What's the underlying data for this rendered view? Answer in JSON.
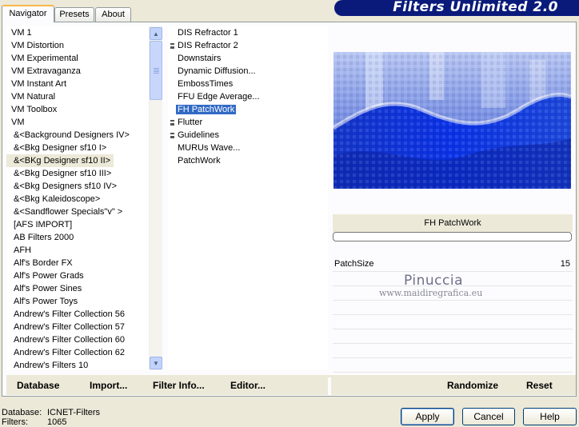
{
  "tabs": [
    {
      "label": "Navigator",
      "active": true
    },
    {
      "label": "Presets",
      "active": false
    },
    {
      "label": "About",
      "active": false
    }
  ],
  "banner": {
    "title": "Filters Unlimited 2.0"
  },
  "categories": {
    "items": [
      "VM 1",
      "VM Distortion",
      "VM Experimental",
      "VM Extravaganza",
      "VM Instant Art",
      "VM Natural",
      "VM Toolbox",
      "VM",
      "&<Background Designers IV>",
      "&<Bkg Designer sf10 I>",
      "&<BKg Designer sf10 II>",
      "&<Bkg Designer sf10 III>",
      "&<Bkg Designers sf10 IV>",
      "&<Bkg Kaleidoscope>",
      "&<Sandflower Specials\"v\" >",
      "[AFS IMPORT]",
      "AB Filters 2000",
      "AFH",
      "Alf's Border FX",
      "Alf's Power Grads",
      "Alf's Power Sines",
      "Alf's Power Toys",
      "Andrew's Filter Collection 56",
      "Andrew's Filter Collection 57",
      "Andrew's Filter Collection 60",
      "Andrew's Filter Collection 62",
      "Andrew's Filters 10"
    ],
    "selected": "&<BKg Designer sf10 II>"
  },
  "filters": {
    "items": [
      {
        "label": "DIS Refractor 1",
        "marker": false
      },
      {
        "label": "DIS Refractor 2",
        "marker": true
      },
      {
        "label": "Downstairs",
        "marker": false
      },
      {
        "label": "Dynamic Diffusion...",
        "marker": false
      },
      {
        "label": "EmbossTimes",
        "marker": false
      },
      {
        "label": "FFU Edge Average...",
        "marker": false
      },
      {
        "label": "FH PatchWork",
        "marker": false
      },
      {
        "label": "Flutter",
        "marker": true
      },
      {
        "label": "Guidelines",
        "marker": true
      },
      {
        "label": "MURUs Wave...",
        "marker": false
      },
      {
        "label": "PatchWork",
        "marker": false
      }
    ],
    "selected": "FH PatchWork"
  },
  "preview": {
    "filter_name": "FH PatchWork",
    "progress": 0,
    "params": [
      {
        "label": "PatchSize",
        "value": "15"
      }
    ],
    "watermark_name": "Pinuccia",
    "watermark_url": "www.maidiregrafica.eu"
  },
  "bottom": {
    "database": "Database",
    "import": "Import...",
    "filter_info": "Filter Info...",
    "editor": "Editor...",
    "randomize": "Randomize",
    "reset": "Reset"
  },
  "status": {
    "database_label": "Database:",
    "database_value": "ICNET-Filters",
    "filters_label": "Filters:",
    "filters_value": "1065"
  },
  "buttons": {
    "apply": "Apply",
    "cancel": "Cancel",
    "help": "Help"
  },
  "colors": {
    "selection": "#316ac5",
    "banner": "#0a1a7a",
    "accent_tab": "#f9b74b"
  }
}
